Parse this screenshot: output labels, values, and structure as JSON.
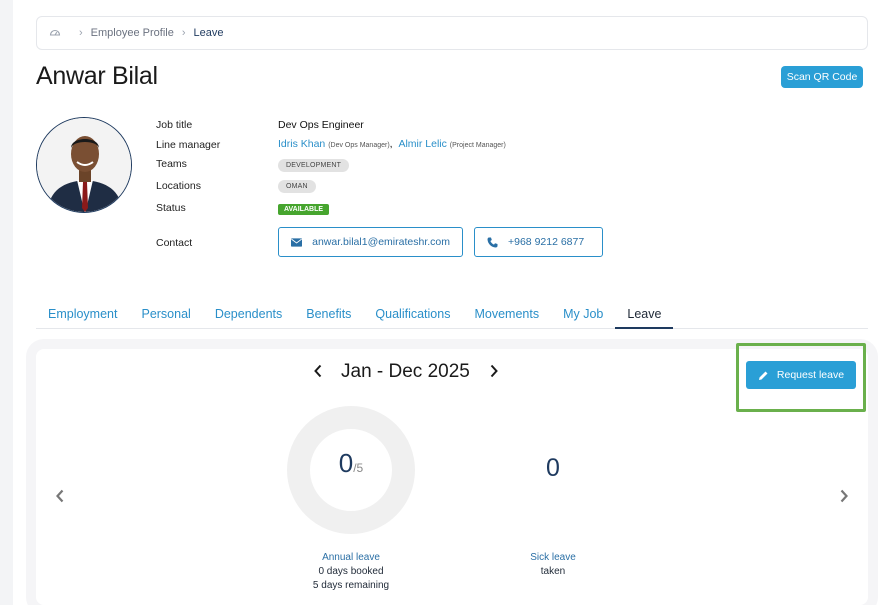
{
  "breadcrumb": {
    "home_icon": "dashboard-icon",
    "items": [
      "Employee Profile",
      "Leave"
    ]
  },
  "profile": {
    "name": "Anwar Bilal",
    "scan_qr_label": "Scan QR Code",
    "fields": {
      "job_title_label": "Job title",
      "job_title": "Dev Ops Engineer",
      "line_manager_label": "Line manager",
      "manager1_name": "Idris Khan",
      "manager1_role": "(Dev Ops Manager)",
      "manager_sep": ",",
      "manager2_name": "Almir Lelic",
      "manager2_role": "(Project Manager)",
      "teams_label": "Teams",
      "team": "DEVELOPMENT",
      "locations_label": "Locations",
      "location": "OMAN",
      "status_label": "Status",
      "status": "AVAILABLE",
      "contact_label": "Contact",
      "email": "anwar.bilal1@emirateshr.com",
      "phone": "+968 9212 6877"
    }
  },
  "tabs": [
    "Employment",
    "Personal",
    "Dependents",
    "Benefits",
    "Qualifications",
    "Movements",
    "My Job",
    "Leave"
  ],
  "active_tab": "Leave",
  "leave": {
    "period": "Jan - Dec 2025",
    "request_label": "Request leave",
    "annual": {
      "value": "0",
      "total": "/5",
      "title": "Annual leave",
      "booked": "0 days booked",
      "remaining": "5 days remaining",
      "fraction_used": 0
    },
    "sick": {
      "value": "0",
      "title": "Sick leave",
      "sub": "taken"
    }
  },
  "colors": {
    "accent": "#2a9fd6",
    "link": "#2a8fc9",
    "navy": "#1e3a5f",
    "status_green": "#46a52e",
    "highlight_outline": "#6ab04c"
  }
}
